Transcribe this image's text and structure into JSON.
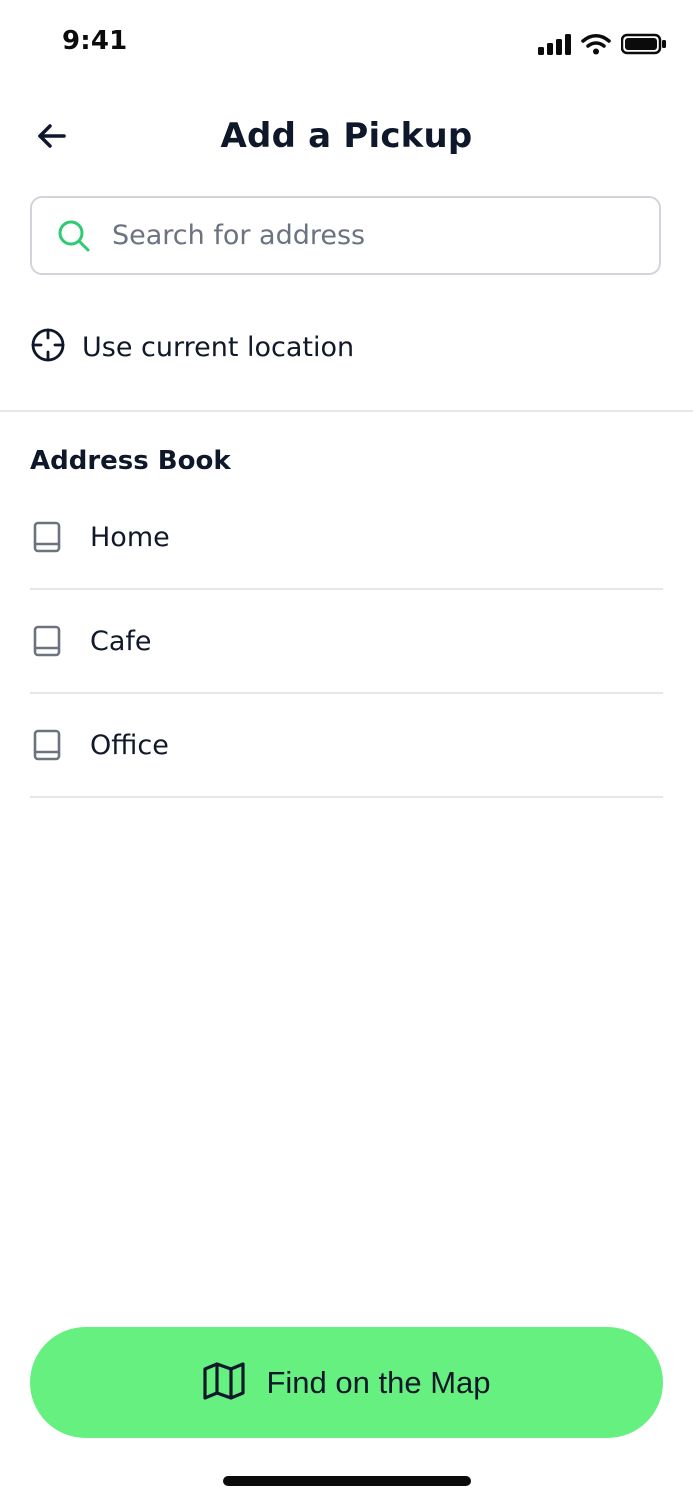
{
  "status_bar": {
    "time": "9:41",
    "icons": [
      "signal-icon",
      "wifi-icon",
      "battery-icon"
    ]
  },
  "header": {
    "title": "Add a Pickup",
    "back_icon": "arrow-left-icon"
  },
  "search": {
    "placeholder": "Search for address",
    "value": "",
    "icon": "search-icon"
  },
  "current_location": {
    "label": "Use current location",
    "icon": "crosshair-icon"
  },
  "address_book": {
    "title": "Address Book",
    "items": [
      {
        "label": "Home",
        "icon": "book-icon"
      },
      {
        "label": "Cafe",
        "icon": "book-icon"
      },
      {
        "label": "Office",
        "icon": "book-icon"
      }
    ]
  },
  "cta": {
    "label": "Find on the Map",
    "icon": "map-icon"
  },
  "colors": {
    "accent": "#66f080",
    "search_icon": "#2ecc71",
    "text": "#0f172a",
    "muted": "#6b7280",
    "divider": "#e5e7eb"
  }
}
